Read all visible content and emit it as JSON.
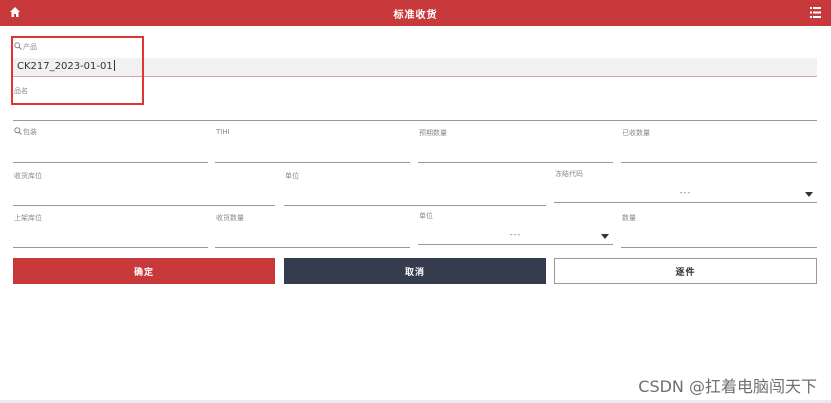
{
  "header": {
    "title": "标准收货",
    "home_icon": "home-icon",
    "menu_icon": "menu-icon"
  },
  "form": {
    "product_label": "产品",
    "product_value": "CK217_2023-01-01",
    "name_label": "品名",
    "package_label": "包装",
    "tihi_label": "TIHI",
    "expected_qty_label": "预期数量",
    "received_qty_label": "已收数量",
    "receiving_location_label": "收货库位",
    "unit_label": "单位",
    "freeze_code_label": "冻结代码",
    "freeze_code_value": "---",
    "putaway_location_label": "上架库位",
    "receiving_qty_label": "收货数量",
    "unit2_label": "单位",
    "unit2_value": "---",
    "quantity_label": "数量"
  },
  "buttons": {
    "confirm": "确定",
    "cancel": "取消",
    "single": "逐件"
  },
  "colors": {
    "header": "#c8393b",
    "confirm": "#c8393b",
    "cancel": "#343c4e",
    "highlight": "#e03535"
  },
  "watermark": "CSDN @扛着电脑闯天下"
}
